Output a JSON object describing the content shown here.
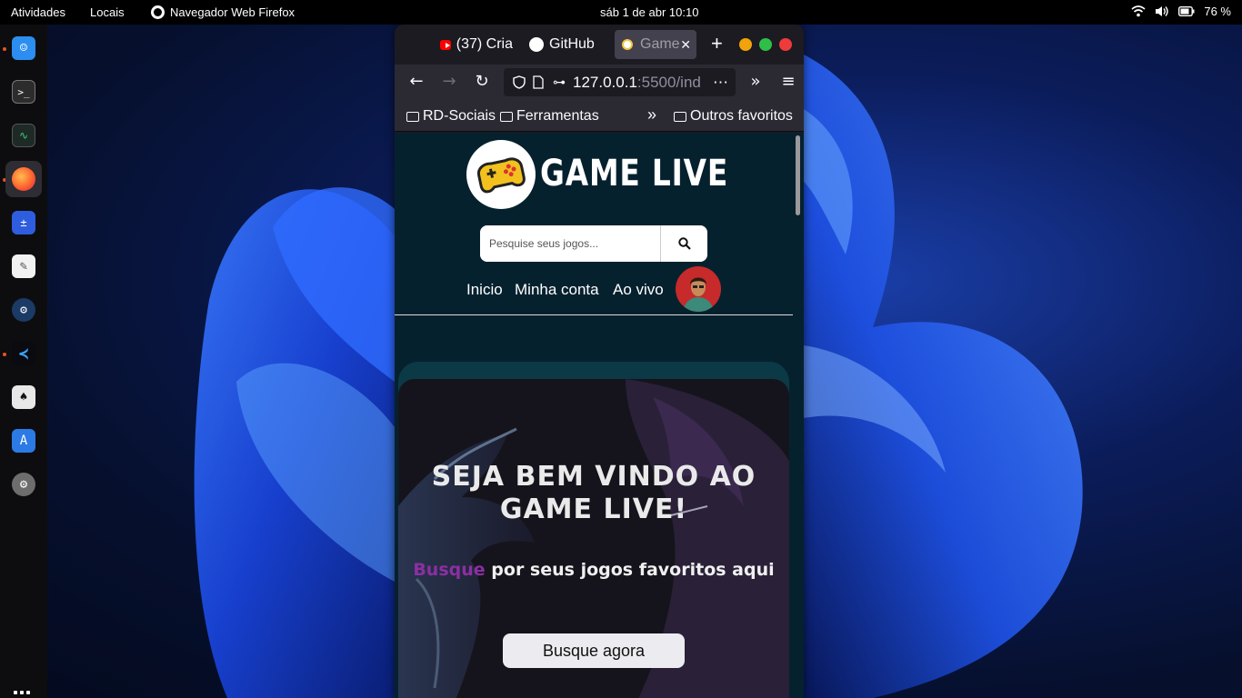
{
  "topbar": {
    "activities": "Atividades",
    "places": "Locais",
    "app_name": "Navegador Web Firefox",
    "clock": "sáb 1 de abr  10:10",
    "battery": "76 %"
  },
  "dock": {
    "items": [
      "files-icon",
      "terminal-icon",
      "system-monitor-icon",
      "firefox-icon",
      "calculator-icon",
      "text-editor-icon",
      "steam-icon",
      "vscode-icon",
      "solitaire-icon",
      "app-center-icon",
      "settings-icon"
    ],
    "apps_grid": "show-apps-icon"
  },
  "browser": {
    "tabs": [
      {
        "label": "(37) Cria",
        "icon": "youtube-icon"
      },
      {
        "label": "GitHub",
        "icon": "github-icon"
      },
      {
        "label": "Game",
        "icon": "game-live-icon"
      }
    ],
    "new_tab": "+",
    "url_host": "127.0.0.1",
    "url_rest": ":5500/ind",
    "url_more": "⋯",
    "bookmarks": [
      "RD-Sociais",
      "Ferramentas"
    ],
    "other_bookmarks": "Outros favoritos",
    "bookmarks_overflow": "»"
  },
  "page": {
    "logo_text": "GAME LIVE",
    "search_placeholder": "Pesquise seus jogos...",
    "menu": [
      "Inicio",
      "Minha conta",
      "Ao vivo"
    ],
    "hero_title": "SEJA BEM VINDO AO GAME LIVE!",
    "hero_accent": "Busque",
    "hero_sub_rest": " por seus jogos favoritos aqui",
    "hero_button": "Busque agora"
  },
  "colors": {
    "page_bg": "#06212e",
    "banner_frame": "#0b3946",
    "accent_purple": "#8b2fa3",
    "ubuntu_orange": "#e95420"
  }
}
